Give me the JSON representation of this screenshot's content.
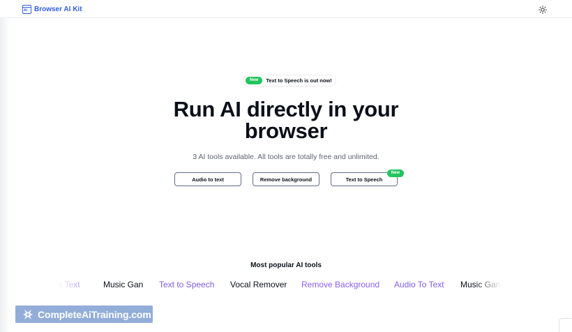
{
  "header": {
    "brand_logo_text": "AI",
    "brand_name": "Browser AI Kit",
    "theme_icon": "sun-icon"
  },
  "announcement": {
    "badge": "New",
    "text": "Text to Speech is out now!"
  },
  "hero": {
    "title": "Run AI directly in your browser",
    "subtitle": "3 AI tools available. All tools are totally free and unlimited."
  },
  "tools": [
    {
      "label": "Audio to text"
    },
    {
      "label": "Remove background"
    },
    {
      "label": "Text to Speech",
      "badge": "New"
    }
  ],
  "popular": {
    "title": "Most popular AI tools",
    "items": [
      {
        "label": "Audio To Text",
        "color": "#8b5cf6"
      },
      {
        "label": "Music Gan",
        "color": "#0b0f19"
      },
      {
        "label": "Text to Speech",
        "color": "#7c5ce6"
      },
      {
        "label": "Vocal Remover",
        "color": "#0b0f19"
      },
      {
        "label": "Remove Background",
        "color": "#8b5cf6"
      },
      {
        "label": "Audio To Text",
        "color": "#7c5ce6"
      },
      {
        "label": "Music Gan",
        "color": "#0b0f19"
      }
    ]
  },
  "watermark": {
    "text": "CompleteAiTraining.com",
    "icon": "sparkle-logo-icon"
  },
  "colors": {
    "brand": "#2f5fe0",
    "badge_green": "#22c55e",
    "accent_purple": "#8b5cf6"
  }
}
